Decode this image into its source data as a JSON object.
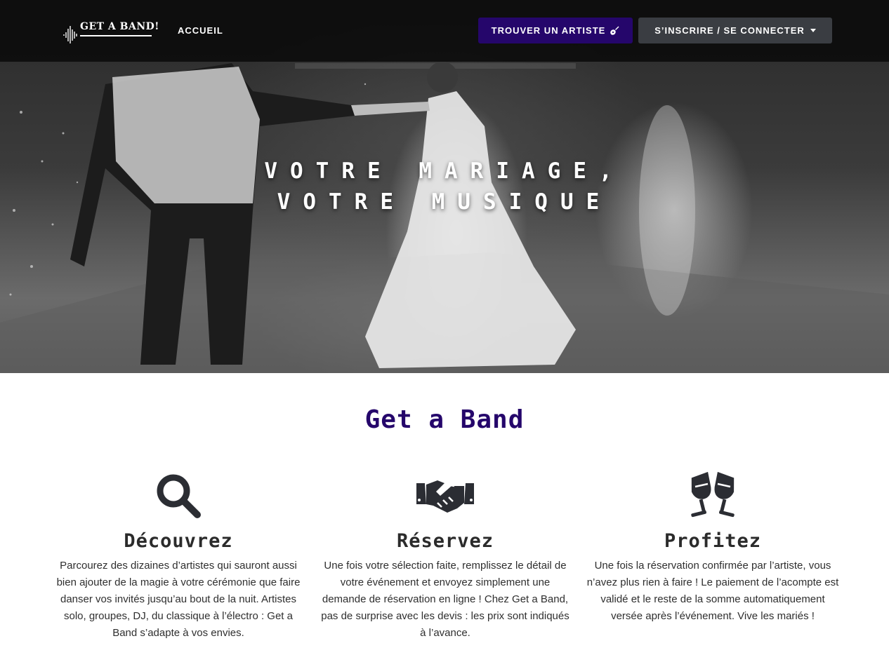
{
  "navbar": {
    "brand": "GET A BAND!",
    "home_link": "ACCUEIL",
    "find_button": "TROUVER UN ARTISTE",
    "find_button_icon": "guitar-icon",
    "account_button": "S’INSCRIRE / SE CONNECTER"
  },
  "hero": {
    "title_line1": "VOTRE MARIAGE,",
    "title_line2": "VOTRE MUSIQUE"
  },
  "main": {
    "title": "Get a Band",
    "features": [
      {
        "icon": "search-icon",
        "heading": "Découvrez",
        "text": "Parcourez des dizaines d’artistes qui sauront aussi bien ajouter de la magie à votre cérémonie que faire danser vos invités jusqu’au bout de la nuit. Artistes solo, groupes, DJ, du classique à l’électro : Get a Band s’adapte à vos envies."
      },
      {
        "icon": "handshake-icon",
        "heading": "Réservez",
        "text": "Une fois votre sélection faite, remplissez le détail de votre événement et envoyez simplement une demande de réservation en ligne ! Chez Get a Band, pas de surprise avec les devis : les prix sont indiqués à l’avance."
      },
      {
        "icon": "champagne-glasses-icon",
        "heading": "Profitez",
        "text": "Une fois la réservation confirmée par l’artiste, vous n’avez plus rien à faire ! Le paiement de l’acompte est validé et le reste de la somme automatiquement versée après l’événement. Vive les mariés !"
      }
    ]
  },
  "colors": {
    "accent": "#25066b",
    "secondary_button": "#3a3d42",
    "navbar": "#0a0a0a"
  }
}
